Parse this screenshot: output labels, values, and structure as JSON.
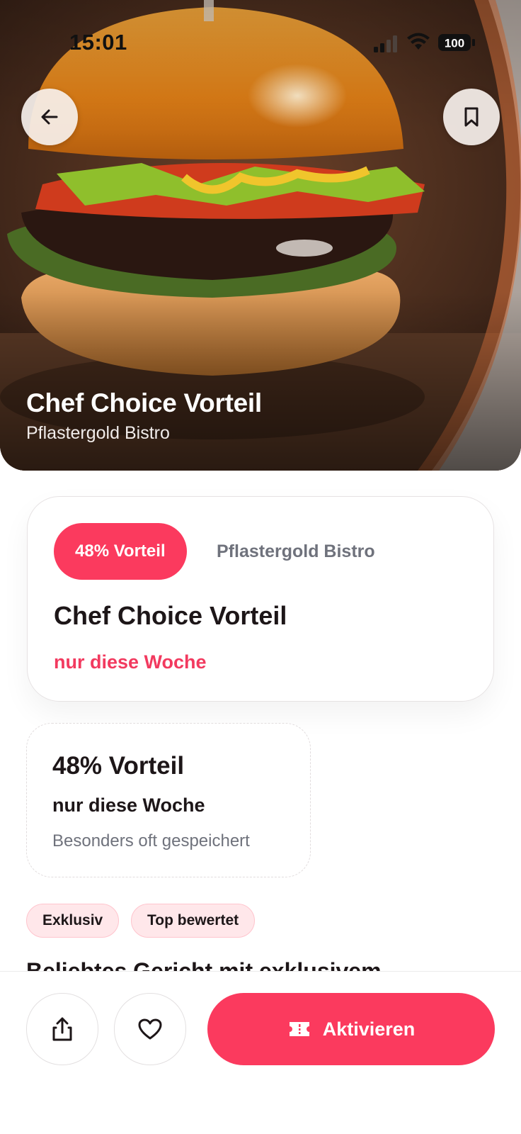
{
  "status_bar": {
    "time": "15:01",
    "battery": "100"
  },
  "hero": {
    "title": "Chef Choice Vorteil",
    "subtitle": "Pflastergold Bistro"
  },
  "offer_card": {
    "discount_label": "48% Vorteil",
    "vendor": "Pflastergold Bistro",
    "title": "Chef Choice Vorteil",
    "period": "nur diese Woche"
  },
  "highlight": {
    "main": "48% Vorteil",
    "sub": "nur diese Woche",
    "note": "Besonders oft gespeichert"
  },
  "tags": [
    "Exklusiv",
    "Top bewertet"
  ],
  "section_peek": "Beliebtes Gericht mit exklusivem",
  "bottom_bar": {
    "activate_label": "Aktivieren"
  },
  "colors": {
    "accent": "#fb3a5e",
    "accent_text": "#f23a5f",
    "tag_bg": "#ffe7ea",
    "muted": "#6f727c"
  }
}
